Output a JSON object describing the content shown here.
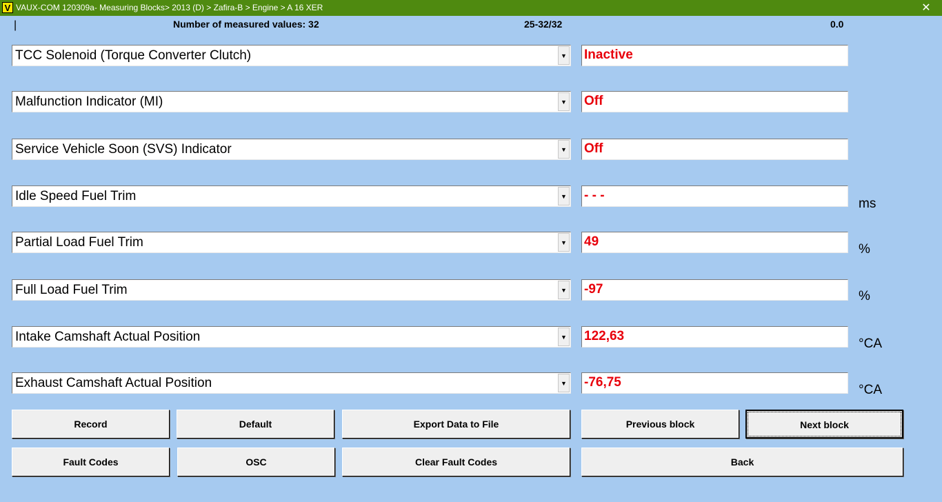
{
  "window": {
    "app_icon": "V",
    "title": "VAUX-COM 120309a- Measuring Blocks> 2013 (D) > Zafira-B > Engine > A 16 XER",
    "close_glyph": "✕"
  },
  "status": {
    "cursor": "|",
    "measured_count_label": "Number of measured values: 32",
    "range": "25-32/32",
    "value": "0.0"
  },
  "rows": [
    {
      "label": "TCC Solenoid (Torque Converter Clutch)",
      "value": "Inactive",
      "unit": ""
    },
    {
      "label": "Malfunction Indicator (MI)",
      "value": "Off",
      "unit": ""
    },
    {
      "label": "Service Vehicle Soon (SVS) Indicator",
      "value": "Off",
      "unit": ""
    },
    {
      "label": "Idle Speed Fuel Trim",
      "value": "- - -",
      "unit": "ms"
    },
    {
      "label": "Partial Load Fuel Trim",
      "value": "49",
      "unit": "%"
    },
    {
      "label": "Full Load Fuel Trim",
      "value": "-97",
      "unit": "%"
    },
    {
      "label": "Intake Camshaft Actual Position",
      "value": "122,63",
      "unit": "°CA"
    },
    {
      "label": "Exhaust Camshaft Actual Position",
      "value": "-76,75",
      "unit": "°CA"
    }
  ],
  "dropdown_arrow": "▼",
  "buttons": {
    "record": "Record",
    "default": "Default",
    "export": "Export Data to File",
    "previous": "Previous block",
    "next": "Next block",
    "fault_codes": "Fault Codes",
    "osc": "OSC",
    "clear_fault_codes": "Clear Fault Codes",
    "back": "Back"
  },
  "colors": {
    "background": "#a6caf0",
    "titlebar": "#4f8a10",
    "value_text": "#e8000b"
  }
}
